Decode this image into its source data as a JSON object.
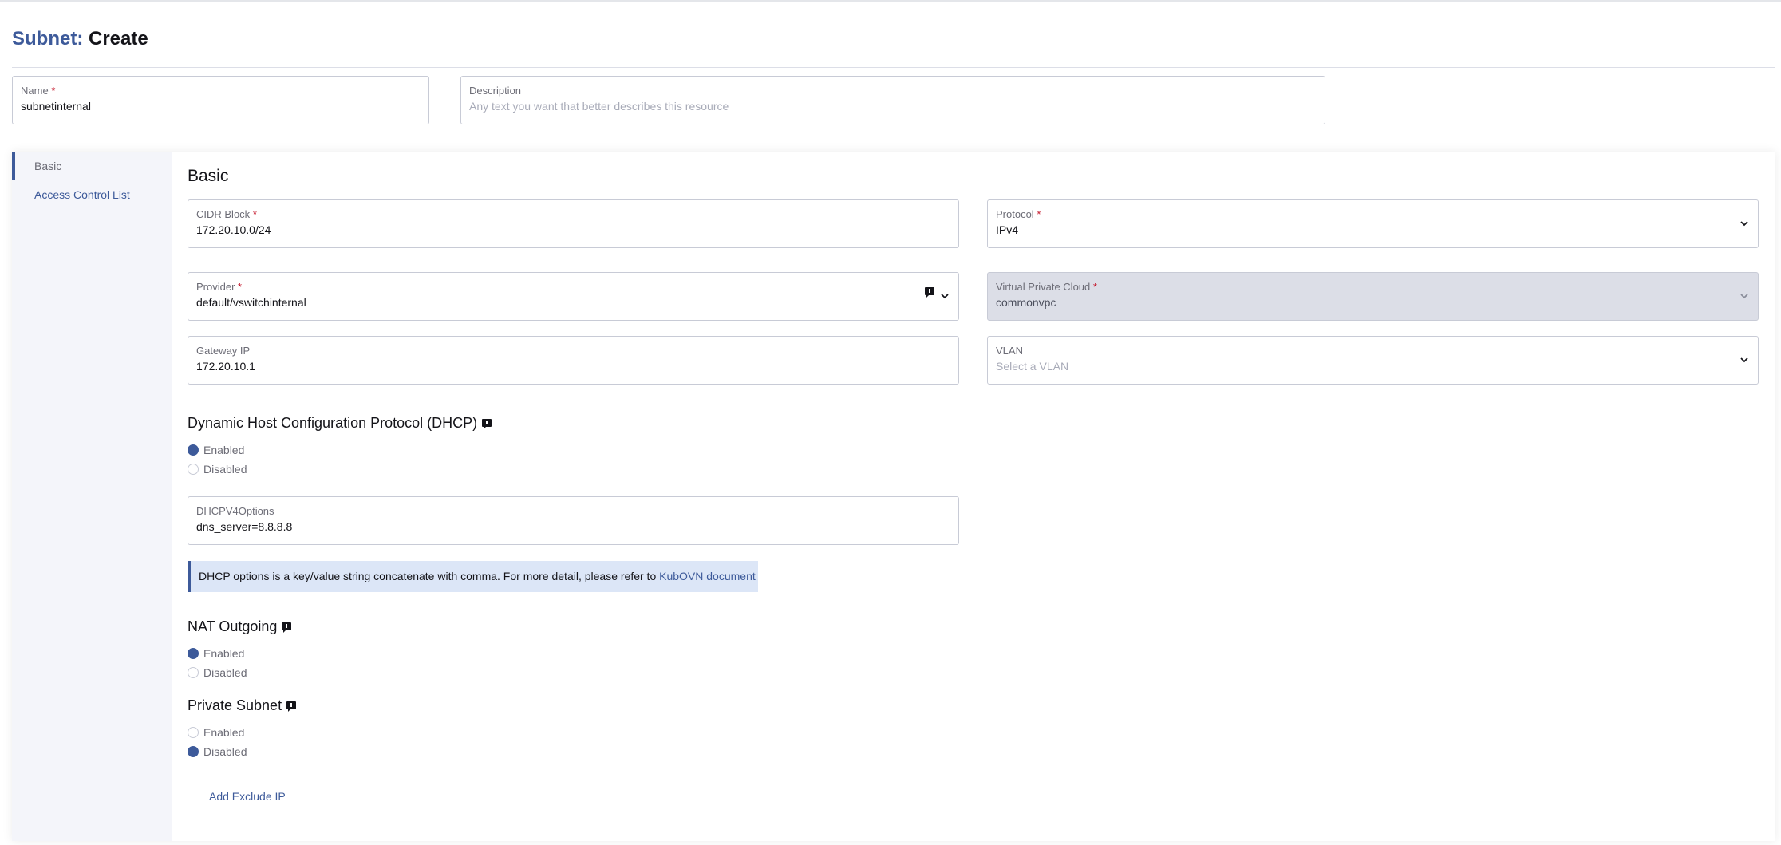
{
  "header": {
    "crumb": "Subnet:",
    "action": "Create"
  },
  "name_field": {
    "label": "Name",
    "required_mark": "*",
    "value": "subnetinternal"
  },
  "description_field": {
    "label": "Description",
    "placeholder": "Any text you want that better describes this resource"
  },
  "sidebar": {
    "items": [
      {
        "label": "Basic",
        "active": true
      },
      {
        "label": "Access Control List",
        "active": false
      }
    ]
  },
  "basic": {
    "title": "Basic",
    "cidr": {
      "label": "CIDR Block",
      "required_mark": "*",
      "value": "172.20.10.0/24"
    },
    "protocol": {
      "label": "Protocol",
      "required_mark": "*",
      "value": "IPv4"
    },
    "provider": {
      "label": "Provider",
      "required_mark": "*",
      "value": "default/vswitchinternal"
    },
    "vpc": {
      "label": "Virtual Private Cloud",
      "required_mark": "*",
      "value": "commonvpc",
      "disabled": true
    },
    "gateway": {
      "label": "Gateway IP",
      "value": "172.20.10.1"
    },
    "vlan": {
      "label": "VLAN",
      "placeholder": "Select a VLAN"
    }
  },
  "dhcp": {
    "title": "Dynamic Host Configuration Protocol (DHCP)",
    "options": [
      {
        "label": "Enabled",
        "checked": true
      },
      {
        "label": "Disabled",
        "checked": false
      }
    ],
    "v4options": {
      "label": "DHCPV4Options",
      "value": "dns_server=8.8.8.8"
    },
    "banner_text": "DHCP options is a key/value string concatenate with comma. For more detail, please refer to",
    "banner_link": "KubOVN document"
  },
  "nat": {
    "title": "NAT Outgoing",
    "options": [
      {
        "label": "Enabled",
        "checked": true
      },
      {
        "label": "Disabled",
        "checked": false
      }
    ]
  },
  "private_subnet": {
    "title": "Private Subnet",
    "options": [
      {
        "label": "Enabled",
        "checked": false
      },
      {
        "label": "Disabled",
        "checked": true
      }
    ]
  },
  "add_exclude_ip_label": "Add Exclude IP",
  "colors": {
    "accent": "#3d5a9a",
    "required": "#c4162a",
    "banner_bg": "#dce6f7",
    "disabled_bg": "#dcdee7"
  },
  "icons": {
    "chevron": "chevron-down-icon",
    "info": "info-icon"
  }
}
